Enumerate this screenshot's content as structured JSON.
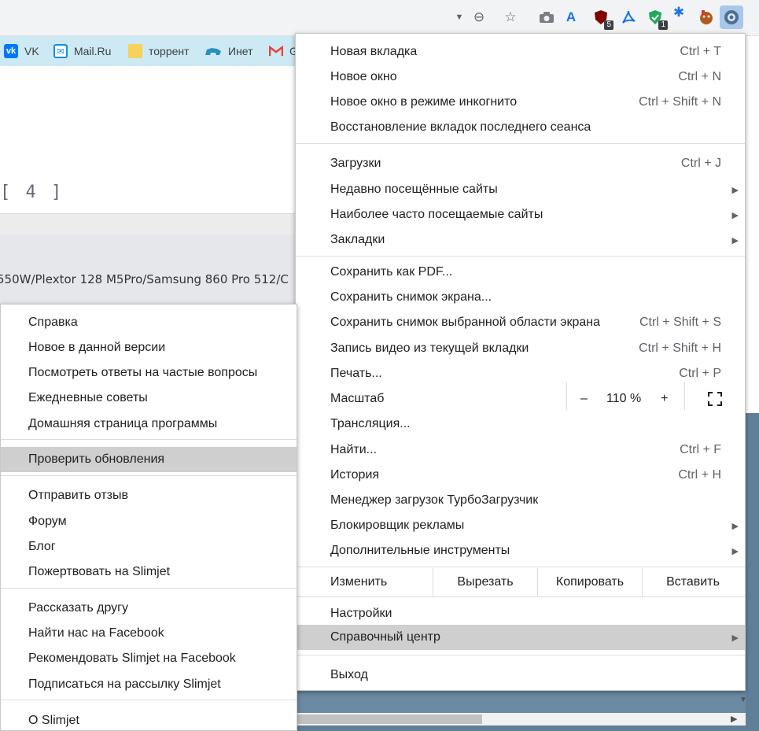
{
  "toolbar": {
    "icons": [
      {
        "name": "dropdown-arrow-icon",
        "glyph": "▼"
      },
      {
        "name": "zoom-out-icon",
        "glyph": "⊖"
      },
      {
        "name": "bookmark-star-icon",
        "glyph": "☆"
      },
      {
        "name": "camera-icon",
        "glyph": "📷"
      },
      {
        "name": "translate-icon",
        "glyph": "A"
      },
      {
        "name": "ublock-icon",
        "glyph": "◈",
        "badge": "5"
      },
      {
        "name": "acrobat-icon",
        "glyph": "✧"
      },
      {
        "name": "shield-check-icon",
        "glyph": "✓",
        "badge": "1"
      },
      {
        "name": "puzzle-icon",
        "glyph": "✱"
      },
      {
        "name": "avatar-icon",
        "glyph": "☻"
      },
      {
        "name": "settings-gear-icon",
        "glyph": "⚙"
      }
    ]
  },
  "bookmarks": [
    {
      "label": "VK",
      "icon": "vk-icon",
      "color": "#0077ff"
    },
    {
      "label": "Mail.Ru",
      "icon": "mail-ru-icon",
      "color": "#168de2"
    },
    {
      "label": "торрент",
      "icon": "folder-icon",
      "color": "#f6d15c"
    },
    {
      "label": "Инет",
      "icon": "bear-icon",
      "color": "#2a8fbd"
    },
    {
      "label": "G",
      "icon": "gmail-icon",
      "color": "#ea4335"
    }
  ],
  "page": {
    "index_text": "[ 4 ]",
    "spec_text": "550W/Plextor 128 M5Pro/Samsung 860 Pro 512/C"
  },
  "main_menu": {
    "group1": [
      {
        "label": "Новая вкладка",
        "shortcut": "Ctrl + T"
      },
      {
        "label": "Новое окно",
        "shortcut": "Ctrl + N"
      },
      {
        "label": "Новое окно в режиме инкогнито",
        "shortcut": "Ctrl + Shift + N"
      },
      {
        "label": "Восстановление вкладок последнего сеанса",
        "shortcut": ""
      }
    ],
    "group2": [
      {
        "label": "Загрузки",
        "shortcut": "Ctrl + J"
      },
      {
        "label": "Недавно посещённые сайты",
        "shortcut": ""
      },
      {
        "label": "Наиболее часто посещаемые сайты",
        "shortcut": ""
      },
      {
        "label": "Закладки",
        "shortcut": ""
      }
    ],
    "group3": [
      {
        "label": "Сохранить как PDF...",
        "shortcut": ""
      },
      {
        "label": "Сохранить снимок экрана...",
        "shortcut": ""
      },
      {
        "label": "Сохранить снимок выбранной области экрана",
        "shortcut": "Ctrl + Shift + S"
      },
      {
        "label": "Запись видео из текущей вкладки",
        "shortcut": "Ctrl + Shift + H"
      },
      {
        "label": "Печать...",
        "shortcut": "Ctrl + P"
      }
    ],
    "zoom": {
      "label": "Масштаб",
      "minus": "–",
      "value": "110 %",
      "plus": "+"
    },
    "group4": [
      {
        "label": "Трансляция...",
        "shortcut": ""
      },
      {
        "label": "Найти...",
        "shortcut": "Ctrl + F"
      },
      {
        "label": "История",
        "shortcut": "Ctrl + H"
      },
      {
        "label": "Менеджер загрузок ТурбоЗагрузчик",
        "shortcut": ""
      },
      {
        "label": "Блокировщик рекламы",
        "shortcut": ""
      },
      {
        "label": "Дополнительные инструменты",
        "shortcut": ""
      }
    ],
    "edit": {
      "label": "Изменить",
      "cut": "Вырезать",
      "copy": "Копировать",
      "paste": "Вставить"
    },
    "group5": [
      {
        "label": "Настройки",
        "shortcut": ""
      },
      {
        "label": "Справочный центр",
        "shortcut": ""
      }
    ],
    "exit": "Выход"
  },
  "help_submenu": {
    "group1": [
      "Справка",
      "Новое в данной версии",
      "Посмотреть ответы на частые вопросы",
      "Ежедневные советы",
      "Домашняя страница программы"
    ],
    "group2": [
      "Проверить обновления"
    ],
    "group3": [
      "Отправить отзыв",
      "Форум",
      "Блог",
      "Пожертвовать на Slimjet"
    ],
    "group4": [
      "Рассказать другу",
      "Найти нас на Facebook",
      "Рекомендовать Slimjet на Facebook",
      "Подписаться на рассылку Slimjet"
    ],
    "group5": [
      "О Slimjet"
    ]
  }
}
